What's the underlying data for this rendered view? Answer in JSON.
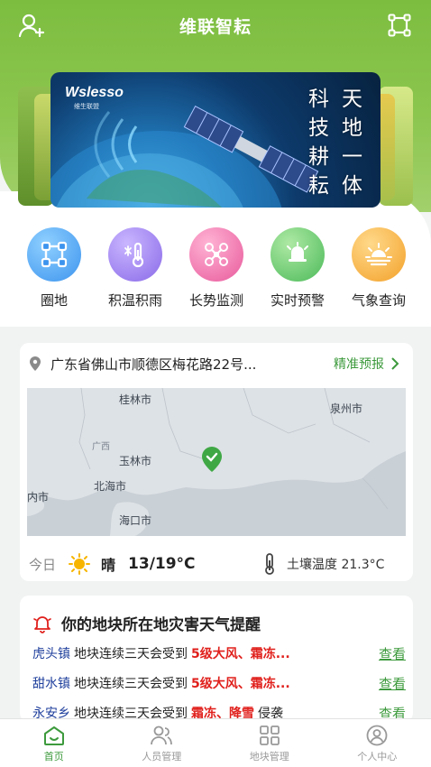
{
  "header": {
    "title": "维联智耘",
    "left_icon": "add-user-icon",
    "right_icon": "scan-frame-icon"
  },
  "banner": {
    "logo": "Wslesso",
    "logo_sub": "维生联盟",
    "poem_col1": [
      "科",
      "技",
      "耕",
      "耘"
    ],
    "poem_col2": [
      "天",
      "地",
      "一",
      "体"
    ]
  },
  "features": [
    {
      "label": "圈地",
      "icon": "enclosure-icon",
      "color": "#4aa3f5"
    },
    {
      "label": "积温积雨",
      "icon": "thermometer-icon",
      "color": "#9b7cf0"
    },
    {
      "label": "长势监测",
      "icon": "drone-icon",
      "color": "#ee6aa8"
    },
    {
      "label": "实时预警",
      "icon": "alarm-icon",
      "color": "#66c46d"
    },
    {
      "label": "气象查询",
      "icon": "sunrise-icon",
      "color": "#f6b13a"
    }
  ],
  "location": {
    "address": "广东省佛山市顺德区梅花路22号...",
    "forecast_link": "精准预报"
  },
  "map": {
    "cities": [
      "桂林市",
      "泉州市",
      "玉林市",
      "北海市",
      "海口市",
      "内市"
    ],
    "regions": [
      "广西"
    ]
  },
  "weather": {
    "day": "今日",
    "condition": "晴",
    "temp": "13/19°C",
    "soil": "土壤温度 21.3°C"
  },
  "alerts": {
    "title": "你的地块所在地灾害天气提醒",
    "items": [
      {
        "town": "虎头镇",
        "desc": "地块连续三天会受到",
        "hazard": "5级大风、霜冻...",
        "tail": "",
        "view": "查看"
      },
      {
        "town": "甜水镇",
        "desc": "地块连续三天会受到",
        "hazard": "5级大风、霜冻...",
        "tail": "",
        "view": "查看"
      },
      {
        "town": "永安乡",
        "desc": "地块连续三天会受到",
        "hazard": "霜冻、降雪",
        "tail": "侵袭",
        "view": "查看"
      }
    ]
  },
  "tabs": [
    {
      "label": "首页",
      "icon": "home-icon",
      "active": true
    },
    {
      "label": "人员管理",
      "icon": "people-icon",
      "active": false
    },
    {
      "label": "地块管理",
      "icon": "grid-icon",
      "active": false
    },
    {
      "label": "个人中心",
      "icon": "profile-icon",
      "active": false
    }
  ],
  "colors": {
    "brand_green": "#7cbd3f",
    "link_green": "#3d9a3d",
    "alert_red": "#e0201c",
    "town_blue": "#1f3f9c"
  }
}
